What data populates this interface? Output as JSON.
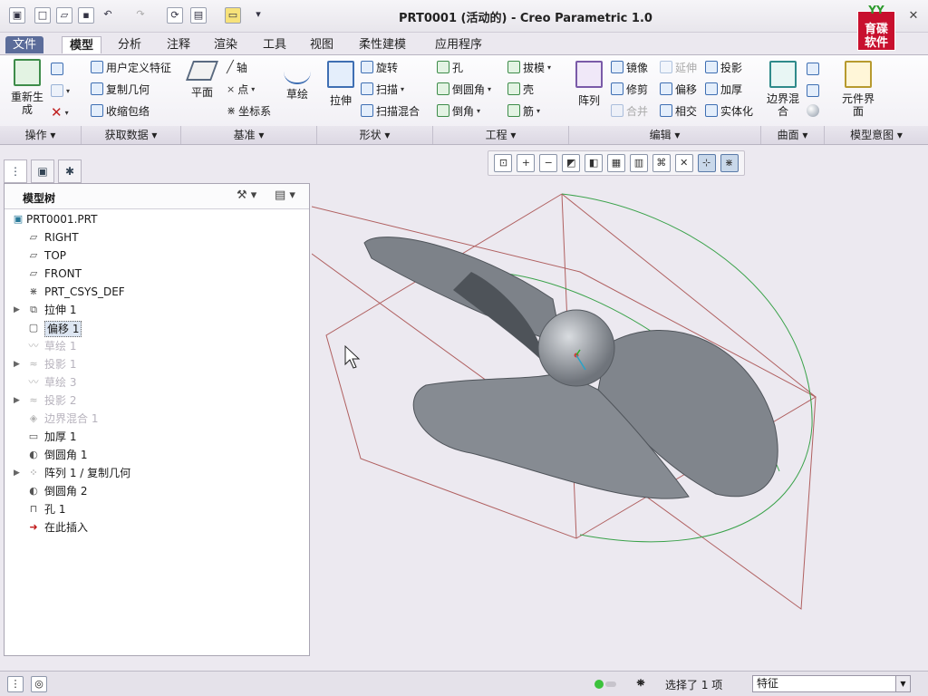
{
  "window": {
    "title": "PRT0001 (活动的) - Creo Parametric 1.0",
    "brand_top": "YY",
    "brand_line1": "育碟",
    "brand_line2": "软件"
  },
  "tabs": [
    "文件",
    "模型",
    "分析",
    "注释",
    "渲染",
    "工具",
    "视图",
    "柔性建模",
    "应用程序"
  ],
  "ribbon": {
    "regenerate": "重新生成",
    "user_feature": "用户定义特征",
    "copy_geometry": "复制几何",
    "shrinkwrap": "收缩包络",
    "plane": "平面",
    "axis": "轴",
    "point": "点",
    "csys": "坐标系",
    "sketch": "草绘",
    "extrude": "拉伸",
    "revolve": "旋转",
    "sweep": "扫描",
    "swept_blend": "扫描混合",
    "hole": "孔",
    "round": "倒圆角",
    "chamfer": "倒角",
    "draft": "拔模",
    "shell": "壳",
    "rib": "筋",
    "pattern": "阵列",
    "mirror": "镜像",
    "extend": "延伸",
    "project": "投影",
    "trim": "修剪",
    "offset": "偏移",
    "thicken": "加厚",
    "merge": "合并",
    "intersect": "相交",
    "solidify": "实体化",
    "boundary_blend": "边界混合",
    "component_interface": "元件界面",
    "groups": [
      "操作",
      "获取数据",
      "基准",
      "形状",
      "工程",
      "编辑",
      "曲面",
      "模型意图"
    ]
  },
  "model_tree": {
    "title": "模型树",
    "items": [
      {
        "label": "PRT0001.PRT",
        "icon": "part-icon",
        "expand": "",
        "state": "normal"
      },
      {
        "label": "RIGHT",
        "icon": "datum-plane-icon",
        "expand": "",
        "state": "normal"
      },
      {
        "label": "TOP",
        "icon": "datum-plane-icon",
        "expand": "",
        "state": "normal"
      },
      {
        "label": "FRONT",
        "icon": "datum-plane-icon",
        "expand": "",
        "state": "normal"
      },
      {
        "label": "PRT_CSYS_DEF",
        "icon": "csys-icon",
        "expand": "",
        "state": "normal"
      },
      {
        "label": "拉伸 1",
        "icon": "extrude-icon",
        "expand": "▶",
        "state": "normal"
      },
      {
        "label": "偏移 1",
        "icon": "offset-icon",
        "expand": "",
        "state": "selected"
      },
      {
        "label": "草绘 1",
        "icon": "sketch-icon",
        "expand": "",
        "state": "suppressed"
      },
      {
        "label": "投影 1",
        "icon": "project-icon",
        "expand": "▶",
        "state": "suppressed"
      },
      {
        "label": "草绘 3",
        "icon": "sketch-icon",
        "expand": "",
        "state": "suppressed"
      },
      {
        "label": "投影 2",
        "icon": "project-icon",
        "expand": "▶",
        "state": "suppressed"
      },
      {
        "label": "边界混合 1",
        "icon": "boundary-blend-icon",
        "expand": "",
        "state": "suppressed"
      },
      {
        "label": "加厚 1",
        "icon": "thicken-icon",
        "expand": "",
        "state": "normal"
      },
      {
        "label": "倒圆角 1",
        "icon": "round-icon",
        "expand": "",
        "state": "normal"
      },
      {
        "label": "阵列 1 / 复制几何",
        "icon": "pattern-icon",
        "expand": "▶",
        "state": "normal"
      },
      {
        "label": "倒圆角 2",
        "icon": "round-icon",
        "expand": "",
        "state": "normal"
      },
      {
        "label": "孔 1",
        "icon": "hole-icon",
        "expand": "",
        "state": "normal"
      },
      {
        "label": "在此插入",
        "icon": "insert-here-icon",
        "expand": "",
        "state": "insert"
      }
    ]
  },
  "status": {
    "selection": "选择了 1 项",
    "filter": "特征"
  },
  "colors": {
    "accent": "#5b6c9a",
    "model_gray": "#7f848c",
    "datum_red": "#a04040",
    "curve_green": "#3aa24a"
  }
}
